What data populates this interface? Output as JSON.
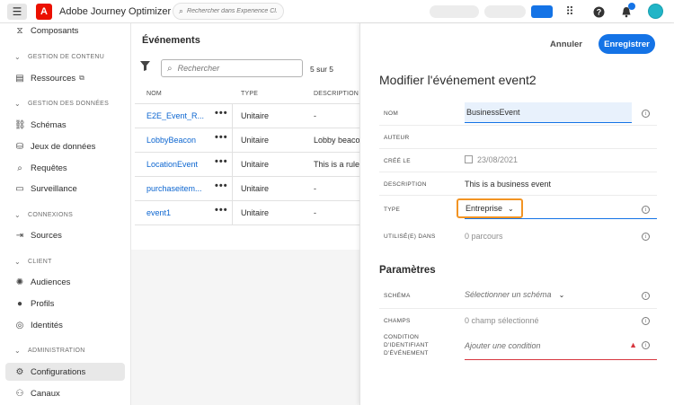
{
  "topbar": {
    "menu_icon": "hamburger-icon",
    "logo_icon": "adobe-logo",
    "logo_letter": "A",
    "app_title": "Adobe Journey Optimizer",
    "search_placeholder": "Rechercher dans Experience Cl...",
    "icons": [
      "apps-grid-icon",
      "help-icon",
      "bell-icon",
      "avatar"
    ],
    "accent": "#1473e6"
  },
  "sidebar": {
    "items": [
      {
        "label": "Composants",
        "icon": "components-icon"
      },
      {
        "section": "GESTION DE CONTENU"
      },
      {
        "label": "Ressources",
        "icon": "assets-icon",
        "external": true
      },
      {
        "section": "GESTION DES DONNÉES"
      },
      {
        "label": "Schémas",
        "icon": "schema-icon"
      },
      {
        "label": "Jeux de données",
        "icon": "datasets-icon"
      },
      {
        "label": "Requêtes",
        "icon": "queries-icon"
      },
      {
        "label": "Surveillance",
        "icon": "monitoring-icon"
      },
      {
        "section": "CONNEXIONS"
      },
      {
        "label": "Sources",
        "icon": "sources-icon"
      },
      {
        "section": "CLIENT"
      },
      {
        "label": "Audiences",
        "icon": "audiences-icon"
      },
      {
        "label": "Profils",
        "icon": "profiles-icon"
      },
      {
        "label": "Identités",
        "icon": "identities-icon"
      },
      {
        "section": "ADMINISTRATION"
      },
      {
        "label": "Configurations",
        "icon": "configurations-icon",
        "active": true
      },
      {
        "label": "Canaux",
        "icon": "channels-icon"
      }
    ]
  },
  "events_list": {
    "title": "Événements",
    "search_placeholder": "Rechercher",
    "count": "5 sur 5",
    "columns": [
      "NOM",
      "TYPE",
      "DESCRIPTION"
    ],
    "rows": [
      {
        "name": "E2E_Event_R...",
        "type": "Unitaire",
        "description": "-"
      },
      {
        "name": "LobbyBeacon",
        "type": "Unitaire",
        "description": "Lobby beacon"
      },
      {
        "name": "LocationEvent",
        "type": "Unitaire",
        "description": "This is a rule-b"
      },
      {
        "name": "purchaseitem...",
        "type": "Unitaire",
        "description": "-"
      },
      {
        "name": "event1",
        "type": "Unitaire",
        "description": "-"
      }
    ],
    "row_menu": "•••"
  },
  "edit_panel": {
    "cancel_label": "Annuler",
    "save_label": "Enregistrer",
    "title": "Modifier l'événement event2",
    "fields": {
      "name_label": "NOM",
      "name_value": "BusinessEvent",
      "author_label": "AUTEUR",
      "created_label": "CRÉÉ LE",
      "created_value": "23/08/2021",
      "description_label": "DESCRIPTION",
      "description_value": "This is a business event",
      "type_label": "TYPE",
      "type_value": "Entreprise",
      "used_label": "UTILISÉ(E) DANS",
      "used_value": "0 parcours"
    },
    "parameters": {
      "title": "Paramètres",
      "schema_label": "SCHÉMA",
      "schema_value": "Sélectionner un schéma",
      "fields_label": "CHAMPS",
      "fields_value": "0 champ sélectionné",
      "condition_label_1": "CONDITION",
      "condition_label_2": "D'IDENTIFIANT",
      "condition_label_3": "D'ÉVÉNEMENT",
      "condition_value": "Ajouter une condition"
    },
    "info_glyph": "i",
    "warning_glyph": "▲"
  }
}
